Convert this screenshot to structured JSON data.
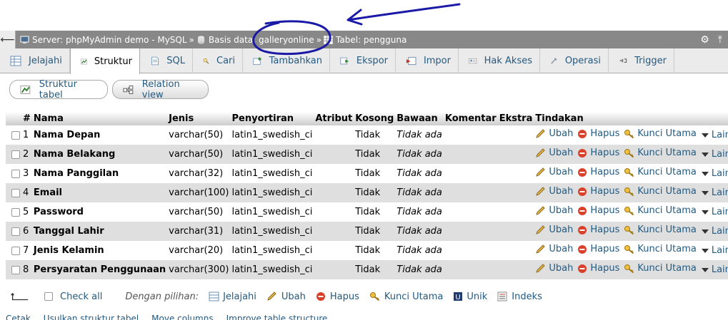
{
  "breadcrumb": {
    "server": "Server: phpMyAdmin demo - MySQL",
    "database": "Basis data: galleryonline",
    "table": "Tabel: pengguna",
    "separator": "»"
  },
  "tabs": [
    {
      "label": "Jelajahi",
      "icon": "browse-icon",
      "active": false
    },
    {
      "label": "Struktur",
      "icon": "structure-icon",
      "active": true
    },
    {
      "label": "SQL",
      "icon": "sql-icon",
      "active": false
    },
    {
      "label": "Cari",
      "icon": "search-icon",
      "active": false
    },
    {
      "label": "Tambahkan",
      "icon": "insert-icon",
      "active": false
    },
    {
      "label": "Ekspor",
      "icon": "export-icon",
      "active": false
    },
    {
      "label": "Impor",
      "icon": "import-icon",
      "active": false
    },
    {
      "label": "Hak Akses",
      "icon": "privileges-icon",
      "active": false
    },
    {
      "label": "Operasi",
      "icon": "wrench-icon",
      "active": false
    },
    {
      "label": "Trigger",
      "icon": "trigger-icon",
      "active": false
    }
  ],
  "subtabs": [
    {
      "label": "Struktur tabel",
      "active": true
    },
    {
      "label": "Relation view",
      "active": false
    }
  ],
  "table": {
    "headers": [
      "",
      "#",
      "Nama",
      "Jenis",
      "Penyortiran",
      "Atribut",
      "Kosong",
      "Bawaan",
      "Komentar",
      "Ekstra",
      "Tindakan"
    ],
    "rows": [
      {
        "num": "1",
        "name": "Nama Depan",
        "type": "varchar(50)",
        "collation": "latin1_swedish_ci",
        "null": "Tidak",
        "default": "Tidak ada"
      },
      {
        "num": "2",
        "name": "Nama Belakang",
        "type": "varchar(50)",
        "collation": "latin1_swedish_ci",
        "null": "Tidak",
        "default": "Tidak ada"
      },
      {
        "num": "3",
        "name": "Nama Panggilan",
        "type": "varchar(32)",
        "collation": "latin1_swedish_ci",
        "null": "Tidak",
        "default": "Tidak ada"
      },
      {
        "num": "4",
        "name": "Email",
        "type": "varchar(100)",
        "collation": "latin1_swedish_ci",
        "null": "Tidak",
        "default": "Tidak ada"
      },
      {
        "num": "5",
        "name": "Password",
        "type": "varchar(50)",
        "collation": "latin1_swedish_ci",
        "null": "Tidak",
        "default": "Tidak ada"
      },
      {
        "num": "6",
        "name": "Tanggal Lahir",
        "type": "varchar(31)",
        "collation": "latin1_swedish_ci",
        "null": "Tidak",
        "default": "Tidak ada"
      },
      {
        "num": "7",
        "name": "Jenis Kelamin",
        "type": "varchar(20)",
        "collation": "latin1_swedish_ci",
        "null": "Tidak",
        "default": "Tidak ada"
      },
      {
        "num": "8",
        "name": "Persyaratan Penggunaan",
        "type": "varchar(300)",
        "collation": "latin1_swedish_ci",
        "null": "Tidak",
        "default": "Tidak ada"
      }
    ],
    "actions": {
      "edit": "Ubah",
      "drop": "Hapus",
      "primary": "Kunci Utama",
      "more": "Lainnya"
    }
  },
  "footer": {
    "check_all": "Check all",
    "with_selected": "Dengan pilihan:",
    "browse": "Jelajahi",
    "edit": "Ubah",
    "drop": "Hapus",
    "primary": "Kunci Utama",
    "unique": "Unik",
    "index": "Indeks"
  },
  "bottom_links": [
    "Cetak",
    "Usulkan struktur tabel",
    "Move columns",
    "Improve table structure"
  ],
  "colors": {
    "link": "#235a81",
    "topbar": "#888888",
    "annotation": "#1a1aa6"
  }
}
